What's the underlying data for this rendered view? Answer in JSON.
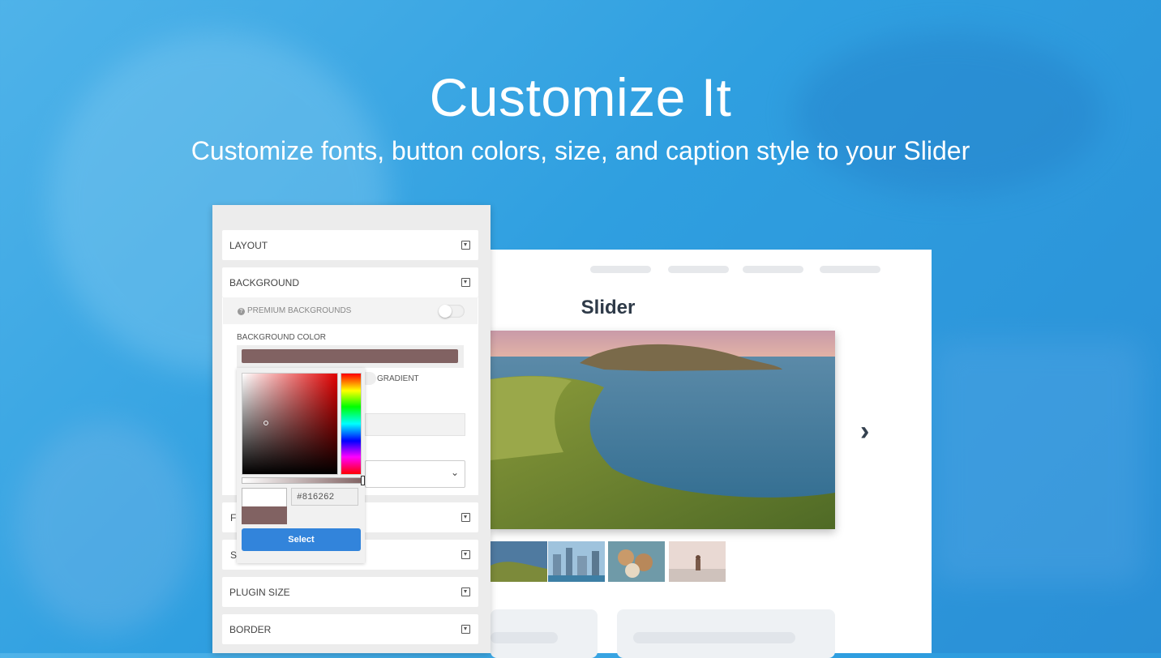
{
  "hero": {
    "title": "Customize It",
    "subtitle": "Customize fonts, button colors, size, and caption style to your Slider"
  },
  "panel": {
    "sections": [
      {
        "label": "LAYOUT"
      },
      {
        "label": "BACKGROUND"
      },
      {
        "label": "PLUGIN SIZE"
      },
      {
        "label": "BORDER"
      }
    ],
    "background": {
      "premium_label": "PREMIUM BACKGROUNDS",
      "color_label": "BACKGROUND COLOR",
      "gradient_label": "GRADIENT",
      "color_value": "#816262"
    },
    "peek_labels": [
      "F",
      "S"
    ]
  },
  "picker": {
    "hex_value": "#816262",
    "select_label": "Select"
  },
  "preview": {
    "title": "Slider",
    "next_arrow": "›"
  },
  "colors": {
    "accent": "#3284db",
    "swatch": "#816262"
  },
  "icons": {
    "accordion": "caret-box-icon",
    "help": "question-circle-icon",
    "next": "chevron-right-icon",
    "dropdown": "chevron-down-icon"
  }
}
